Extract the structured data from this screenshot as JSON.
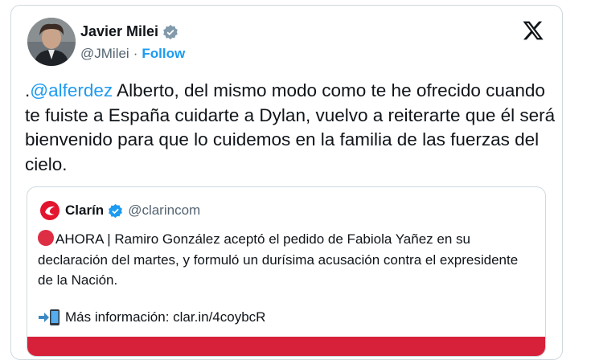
{
  "author": {
    "name": "Javier Milei",
    "handle": "@JMilei",
    "separator": "·",
    "follow_label": "Follow",
    "verified_icon": "verified-badge-icon"
  },
  "platform_logo": "x-logo-icon",
  "tweet": {
    "prefix": ".",
    "mention": "@alferdez",
    "body": " Alberto, del mismo modo como te he ofrecido cuando te fuiste a España cuidarte a Dylan, vuelvo a reiterarte que él será bienvenido para que lo cuidemos en la familia de las fuerzas del cielo."
  },
  "quote": {
    "name": "Clarín",
    "handle": "@clarincom",
    "logo": "clarin-logo-icon",
    "text": "AHORA | Ramiro González aceptó el pedido de Fabiola Yañez en su declaración del martes, y formuló un durísima acusación contra el expresidente de la Nación.",
    "more_text": "Más información: clar.in/4coybcR"
  },
  "colors": {
    "accent": "#1d9bf0",
    "text": "#0f1419",
    "muted": "#536471",
    "clarin_red": "#d7213a"
  }
}
